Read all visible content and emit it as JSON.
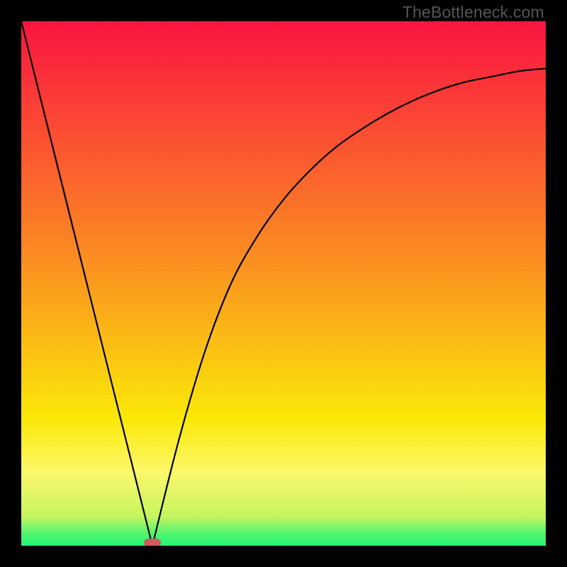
{
  "watermark": "TheBottleneck.com",
  "colors": {
    "red": "#fb1441",
    "yellow": "#fbe908",
    "green": "#22f575",
    "curve": "#000000",
    "marker": "#d25a5b",
    "frame": "#000000"
  },
  "chart_data": {
    "type": "line",
    "title": "",
    "xlabel": "",
    "ylabel": "",
    "xlim": [
      0,
      100
    ],
    "ylim": [
      0,
      100
    ],
    "grid": false,
    "legend": false,
    "series": [
      {
        "name": "left-linear-ramp",
        "x": [
          0,
          25
        ],
        "y": [
          100,
          0
        ]
      },
      {
        "name": "right-decay-curve",
        "x": [
          25,
          30,
          35,
          40,
          45,
          50,
          55,
          60,
          65,
          70,
          75,
          80,
          85,
          90,
          95,
          100
        ],
        "y": [
          0,
          20,
          37,
          50,
          59,
          66,
          71.5,
          76,
          79.5,
          82.5,
          85,
          87,
          88.5,
          89.5,
          90.5,
          91
        ]
      }
    ],
    "annotations": [
      {
        "name": "minimum-marker",
        "x": 25,
        "y": 0,
        "shape": "pill"
      }
    ],
    "gradient_stops": [
      {
        "pos": 0,
        "color": "#fb1441"
      },
      {
        "pos": 44,
        "color": "#fb8a22"
      },
      {
        "pos": 76,
        "color": "#fbe908"
      },
      {
        "pos": 86,
        "color": "#fcf86a"
      },
      {
        "pos": 94.5,
        "color": "#c5f55f"
      },
      {
        "pos": 97.5,
        "color": "#56f56f"
      },
      {
        "pos": 100,
        "color": "#22f575"
      }
    ]
  }
}
